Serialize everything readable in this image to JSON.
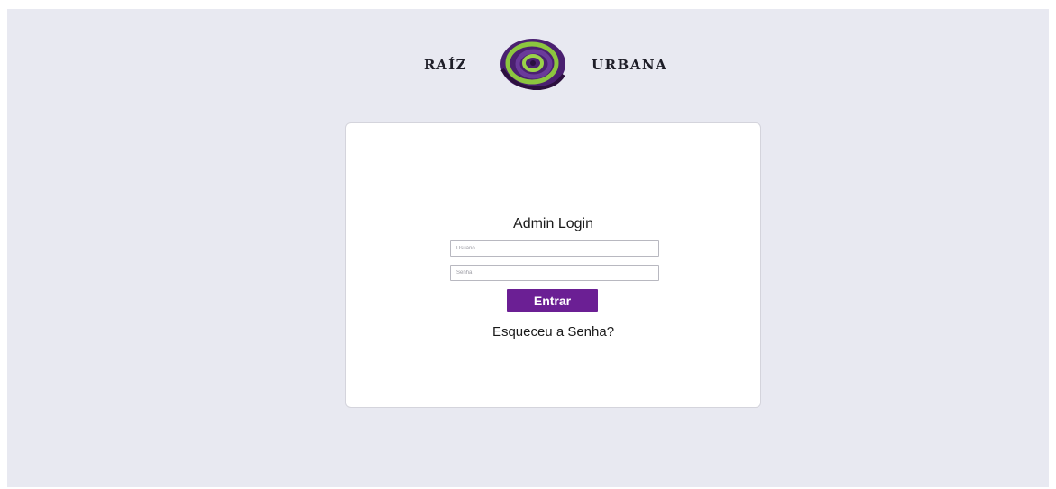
{
  "brand": {
    "left_word": "RAÍZ",
    "right_word": "URBANA",
    "logo_icon": "spiral-logo-icon",
    "logo_colors": [
      "#5b2a86",
      "#8cc63f",
      "#3a1a5a"
    ]
  },
  "login": {
    "title": "Admin Login",
    "username_placeholder": "Usuário",
    "password_placeholder": "Senha",
    "submit_label": "Entrar",
    "forgot_label": "Esqueceu a Senha?"
  },
  "colors": {
    "background": "#e8e9f1",
    "card": "#ffffff",
    "accent": "#6b1f94"
  }
}
